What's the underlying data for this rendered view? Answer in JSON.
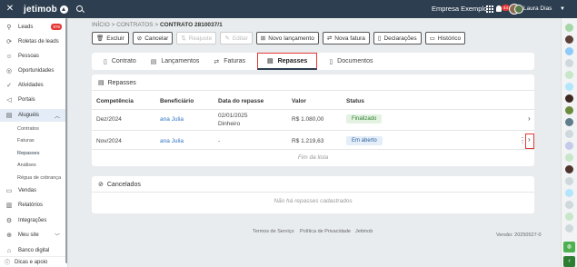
{
  "topbar": {
    "logo": "jetimob",
    "company": "Empresa Exemplo",
    "notifications_badge": "44",
    "user_name": "Laura Dias"
  },
  "sidebar": {
    "items": [
      {
        "label": "Leads",
        "icon": "funnel-icon",
        "badge": "976"
      },
      {
        "label": "Roletas de leads",
        "icon": "roulette-icon"
      },
      {
        "label": "Pessoas",
        "icon": "people-icon"
      },
      {
        "label": "Oportunidades",
        "icon": "opportunity-icon"
      },
      {
        "label": "Atividades",
        "icon": "check-circle-icon"
      },
      {
        "label": "Portais",
        "icon": "megaphone-icon"
      },
      {
        "label": "Aluguéis",
        "icon": "rent-icon"
      },
      {
        "label": "Vendas",
        "icon": "sales-icon"
      },
      {
        "label": "Relatórios",
        "icon": "report-icon"
      },
      {
        "label": "Integrações",
        "icon": "integration-icon"
      },
      {
        "label": "Meu site",
        "icon": "globe-icon"
      },
      {
        "label": "Banco digital",
        "icon": "bank-icon"
      }
    ],
    "rent_subitems": [
      "Contratos",
      "Faturas",
      "Repasses",
      "Análises",
      "Régua de cobrança"
    ],
    "footer": "Dicas e apoio"
  },
  "breadcrumb": {
    "home": "INÍCIO",
    "contracts": "CONTRATOS",
    "current": "CONTRATO 2810037/1"
  },
  "actions": {
    "delete": "Excluir",
    "cancel": "Cancelar",
    "readjust": "Reajuste",
    "edit": "Editar",
    "new_entry": "Novo lançamento",
    "new_invoice": "Nova fatura",
    "declarations": "Declarações",
    "history": "Histórico"
  },
  "tabs": {
    "contract": "Contrato",
    "entries": "Lançamentos",
    "invoices": "Faturas",
    "transfers": "Repasses",
    "documents": "Documentos"
  },
  "repasses": {
    "title": "Repasses",
    "columns": {
      "competence": "Competência",
      "beneficiary": "Beneficiário",
      "date": "Data do repasse",
      "value": "Valor",
      "status": "Status"
    },
    "rows": [
      {
        "competence": "Dez/2024",
        "beneficiary": "ana Julia",
        "date": "02/01/2025",
        "method": "Dinheiro",
        "value": "R$ 1.080,00",
        "status": "Finalizado"
      },
      {
        "competence": "Nov/2024",
        "beneficiary": "ana Julia",
        "date": "-",
        "value": "R$ 1.219,63",
        "status": "Em aberto"
      }
    ],
    "end_text": "Fim da lista"
  },
  "cancelled": {
    "title": "Cancelados",
    "empty_text": "Não há repasses cadastrados"
  },
  "footer": {
    "terms": "Termos de Serviço",
    "privacy": "Política de Privacidade",
    "brand": "Jetimob",
    "version": "Versão: 20250527-0"
  },
  "colors": {
    "topbar": "#2c3e50",
    "accent": "#2f73c4",
    "danger": "#e53935",
    "success": "#2e7d32"
  }
}
